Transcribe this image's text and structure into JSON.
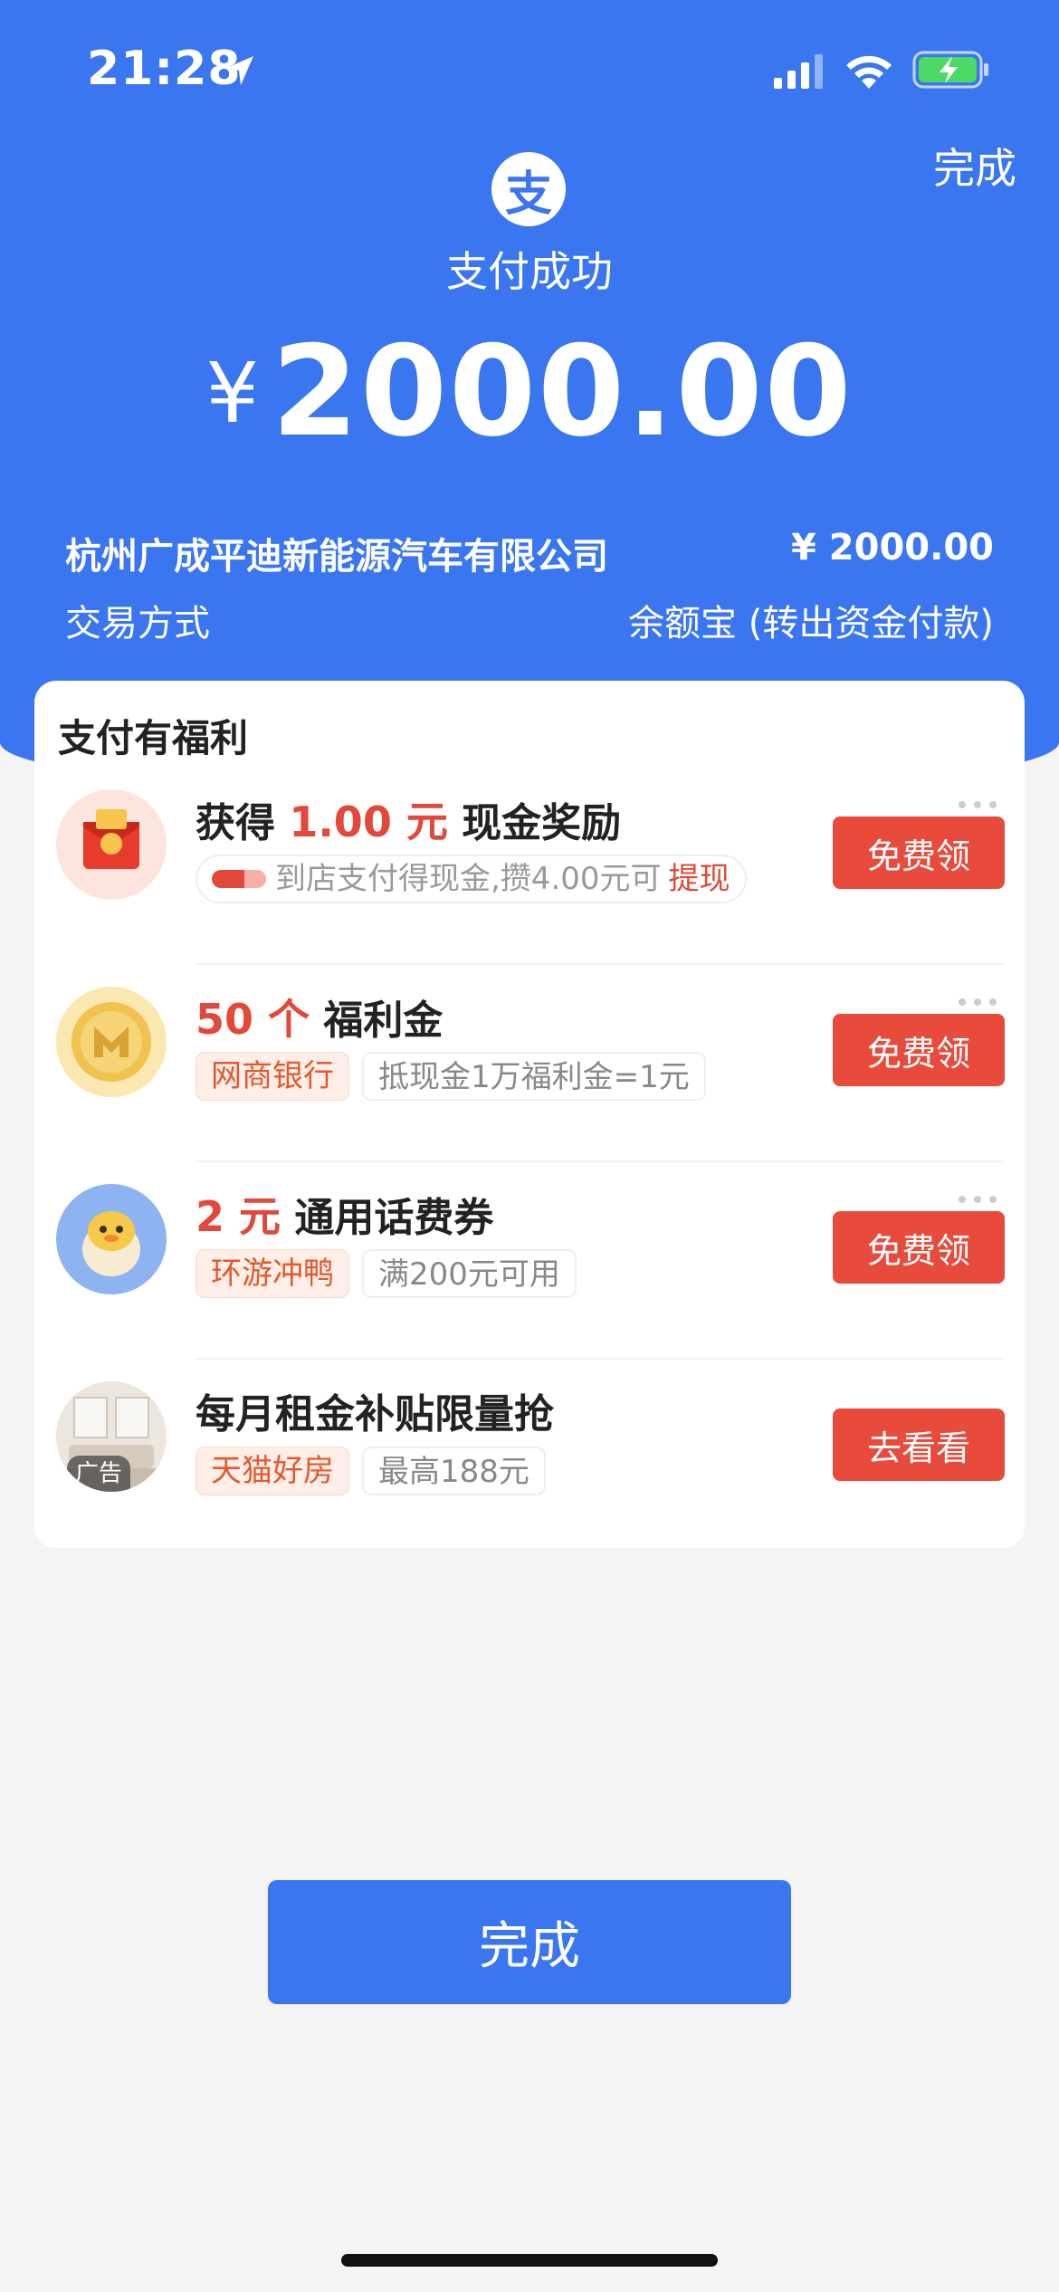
{
  "status_bar": {
    "time": "21:28"
  },
  "header": {
    "done_label": "完成",
    "logo_char": "支",
    "status": "支付成功",
    "currency_symbol": "¥",
    "amount": "2000.00"
  },
  "details": {
    "merchant": "杭州广成平迪新能源汽车有限公司",
    "merchant_amount": "¥ 2000.00",
    "method_label": "交易方式",
    "method_value": "余额宝 (转出资金付款)"
  },
  "benefits": {
    "title": "支付有福利",
    "offers": [
      {
        "headline_pre": "获得",
        "headline_highlight": "1.00 元",
        "headline_post": "现金奖励",
        "tag_text": "到店支付得现金,攒4.00元可",
        "tag_link": "提现",
        "action": "免费领"
      },
      {
        "headline_highlight": "50 个",
        "headline_post": "福利金",
        "tag1": "网商银行",
        "tag2": "抵现金1万福利金=1元",
        "action": "免费领"
      },
      {
        "headline_highlight": "2 元",
        "headline_post": "通用话费券",
        "tag1": "环游冲鸭",
        "tag2": "满200元可用",
        "action": "免费领"
      },
      {
        "headline_post": "每月租金补贴限量抢",
        "tag1": "天猫好房",
        "tag2": "最高188元",
        "ad_label": "广告",
        "action": "去看看"
      }
    ]
  },
  "footer": {
    "done_label": "完成"
  },
  "colors": {
    "primary_blue": "#3a76f0",
    "accent_red": "#e84a3b"
  }
}
